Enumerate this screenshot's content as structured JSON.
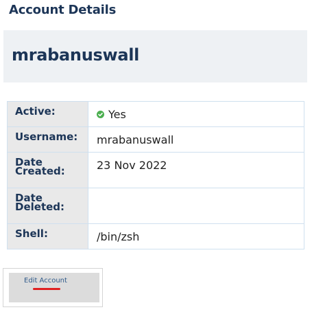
{
  "page": {
    "heading": "Account Details"
  },
  "account": {
    "name": "mrabanuswall"
  },
  "details": {
    "active_label": "Active:",
    "active_value": "Yes",
    "username_label": "Username:",
    "username_value": "mrabanuswall",
    "date_created_label_line1": "Date",
    "date_created_label_line2": "Created:",
    "date_created_value": "23 Nov 2022",
    "date_deleted_label_line1": "Date",
    "date_deleted_label_line2": "Deleted:",
    "date_deleted_value": "",
    "shell_label": "Shell:",
    "shell_value": "/bin/zsh"
  },
  "actions": {
    "edit_label": "Edit Account"
  },
  "icons": {
    "active_status": "check-circle-icon"
  },
  "colors": {
    "heading": "#1c3557",
    "status_ok": "#4caf50",
    "highlight_mark": "#e02020"
  }
}
